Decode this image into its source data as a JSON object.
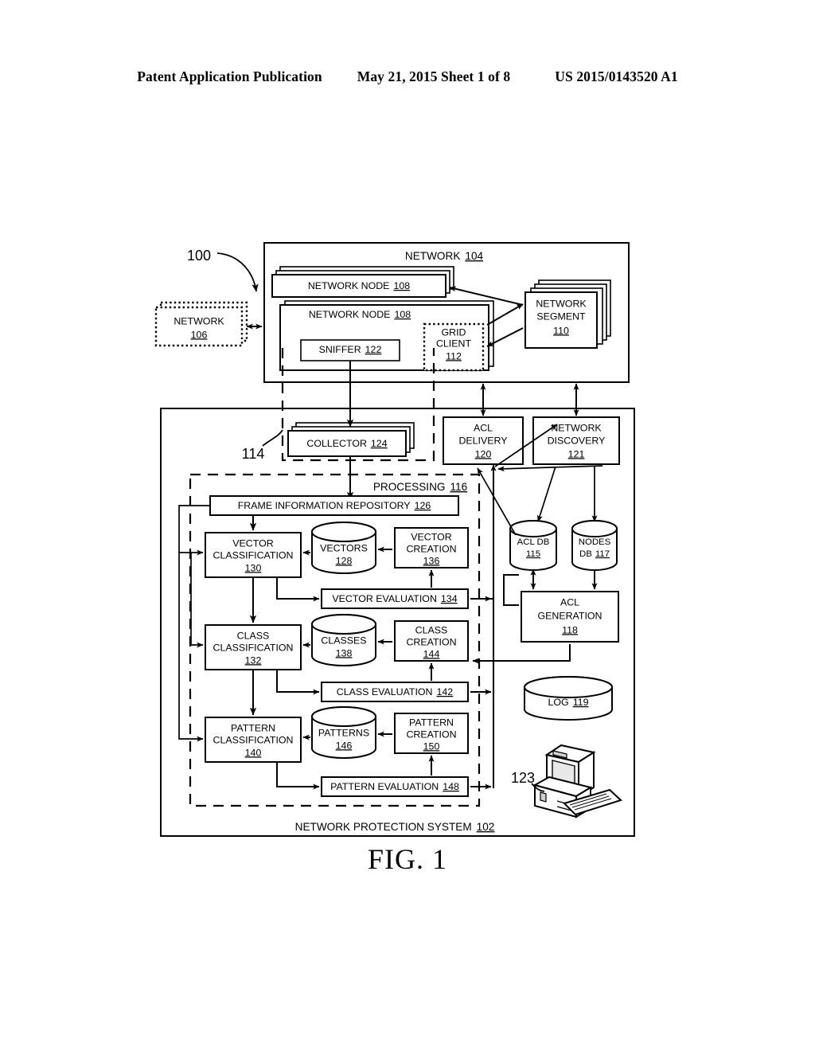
{
  "header": {
    "publication": "Patent Application Publication",
    "date_sheet": "May 21, 2015  Sheet 1 of 8",
    "patent_number": "US 2015/0143520 A1"
  },
  "figure": {
    "caption": "FIG. 1",
    "system_ref": "100",
    "sniffer_group_ref": "114",
    "workstation_ref": "123"
  },
  "network_area": {
    "title": "NETWORK",
    "title_ref": "104",
    "external_network": {
      "label": "NETWORK",
      "ref": "106"
    },
    "node_top": {
      "label": "NETWORK NODE",
      "ref": "108"
    },
    "node_bottom": {
      "label": "NETWORK NODE",
      "ref": "108"
    },
    "sniffer": {
      "label": "SNIFFER",
      "ref": "122"
    },
    "grid_client": {
      "line1": "GRID",
      "line2": "CLIENT",
      "ref": "112"
    },
    "network_segment": {
      "line1": "NETWORK",
      "line2": "SEGMENT",
      "ref": "110"
    }
  },
  "protection_system": {
    "title": "NETWORK PROTECTION SYSTEM",
    "title_ref": "102",
    "collector": {
      "label": "COLLECTOR",
      "ref": "124"
    },
    "acl_delivery": {
      "line1": "ACL",
      "line2": "DELIVERY",
      "ref": "120"
    },
    "network_discovery": {
      "line1": "NETWORK",
      "line2": "DISCOVERY",
      "ref": "121"
    },
    "acl_db": {
      "line1": "ACL DB",
      "ref": "115"
    },
    "nodes_db": {
      "line1": "NODES",
      "line2": "DB",
      "ref": "117"
    },
    "acl_generation": {
      "line1": "ACL",
      "line2": "GENERATION",
      "ref": "118"
    },
    "log": {
      "label": "LOG",
      "ref": "119"
    }
  },
  "processing": {
    "title": "PROCESSING",
    "title_ref": "116",
    "frame_repository": {
      "label": "FRAME INFORMATION REPOSITORY",
      "ref": "126"
    },
    "rows": [
      {
        "classification": {
          "line1": "VECTOR",
          "line2": "CLASSIFICATION",
          "ref": "130"
        },
        "store": {
          "label": "VECTORS",
          "ref": "128"
        },
        "creation": {
          "line1": "VECTOR",
          "line2": "CREATION",
          "ref": "136"
        },
        "evaluation": {
          "label": "VECTOR EVALUATION",
          "ref": "134"
        }
      },
      {
        "classification": {
          "line1": "CLASS",
          "line2": "CLASSIFICATION",
          "ref": "132"
        },
        "store": {
          "label": "CLASSES",
          "ref": "138"
        },
        "creation": {
          "line1": "CLASS",
          "line2": "CREATION",
          "ref": "144"
        },
        "evaluation": {
          "label": "CLASS EVALUATION",
          "ref": "142"
        }
      },
      {
        "classification": {
          "line1": "PATTERN",
          "line2": "CLASSIFICATION",
          "ref": "140"
        },
        "store": {
          "label": "PATTERNS",
          "ref": "146"
        },
        "creation": {
          "line1": "PATTERN",
          "line2": "CREATION",
          "ref": "150"
        },
        "evaluation": {
          "label": "PATTERN EVALUATION",
          "ref": "148"
        }
      }
    ]
  }
}
